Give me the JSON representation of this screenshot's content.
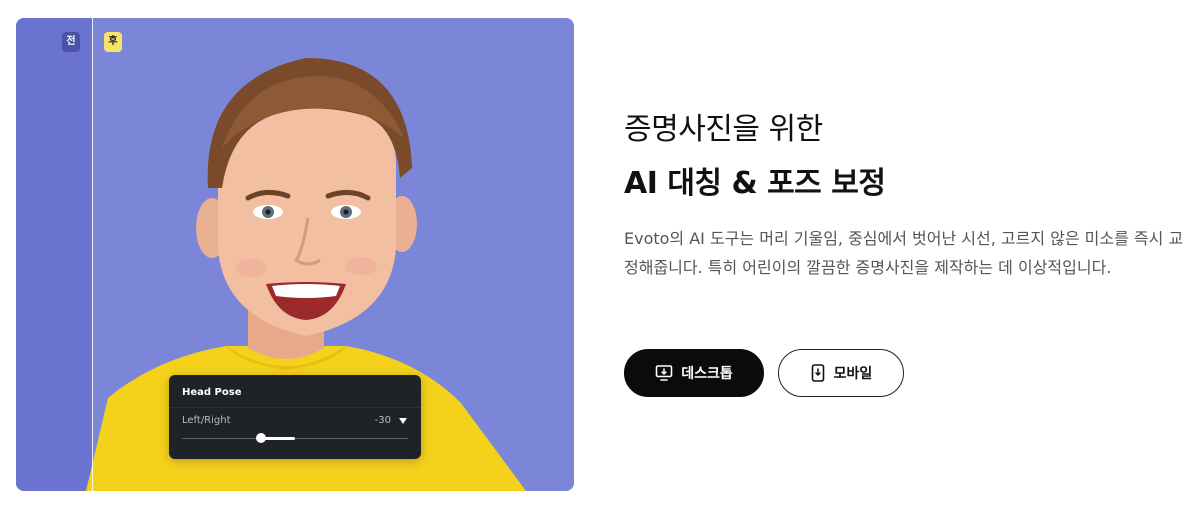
{
  "image": {
    "before_tag": "전",
    "after_tag": "후",
    "pose_panel": {
      "title": "Head Pose",
      "label": "Left/Right",
      "value": "-30",
      "slider_fraction": 0.35,
      "center_fraction": 0.5
    }
  },
  "content": {
    "headline_line1": "증명사진을 위한",
    "headline_line2": "AI 대칭 & 포즈 보정",
    "description": "Evoto의 AI 도구는 머리 기울임, 중심에서 벗어난 시선, 고르지 않은 미소를 즉시 교정해줍니다. 특히 어린이의 깔끔한 증명사진을 제작하는 데 이상적입니다."
  },
  "buttons": {
    "desktop_label": "데스크톱",
    "mobile_label": "모바일",
    "desktop_icon": "desktop-download-icon",
    "mobile_icon": "mobile-download-icon"
  },
  "colors": {
    "background_blue": "#7c86d8",
    "shirt_yellow": "#f4d21b",
    "after_tag": "#f6e36b",
    "primary_button": "#0b0b0b"
  }
}
